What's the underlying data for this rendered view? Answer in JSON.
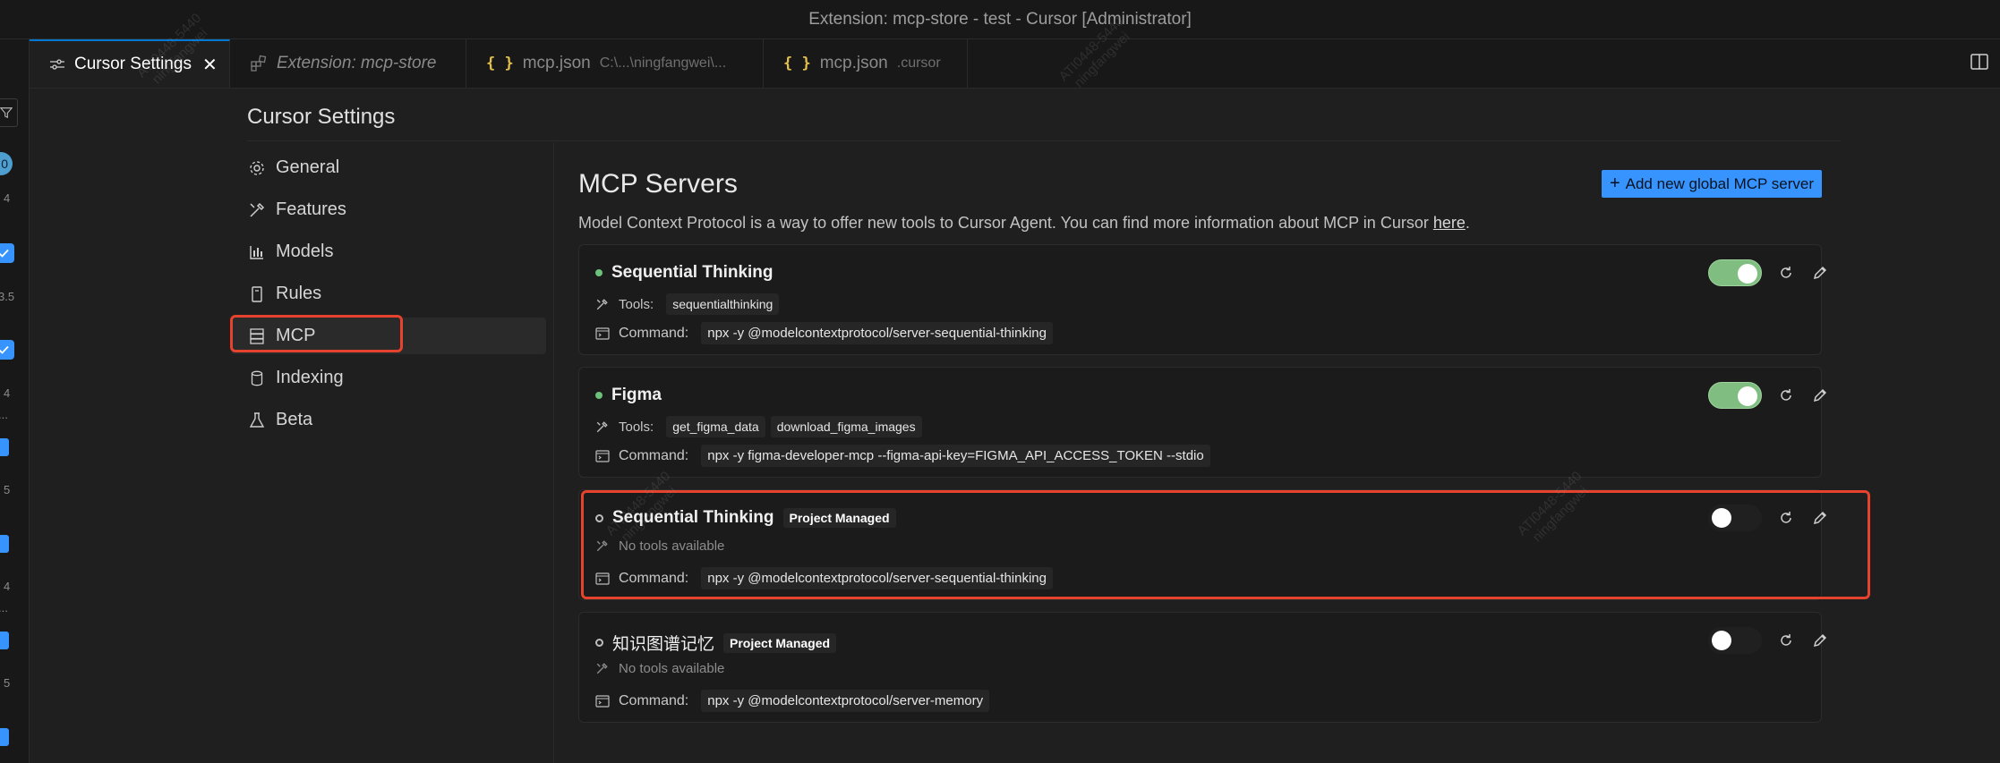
{
  "window": {
    "title": "Extension: mcp-store - test - Cursor [Administrator]"
  },
  "activity": {
    "badge": "0",
    "nums": [
      "4",
      "3.5",
      "4",
      "...",
      "5",
      "4",
      "...",
      "5"
    ]
  },
  "tabs": [
    {
      "label": "Cursor Settings",
      "icon": "settings-sliders-icon",
      "active": true
    },
    {
      "label": "Extension: mcp-store",
      "icon": "extensions-icon",
      "active": false
    },
    {
      "label": "mcp.json",
      "sub": "C:\\...\\ningfangwei\\...",
      "icon": "json-icon",
      "active": false
    },
    {
      "label": "mcp.json",
      "sub": ".cursor",
      "icon": "json-icon",
      "active": false
    }
  ],
  "settings": {
    "title": "Cursor Settings",
    "nav": [
      {
        "label": "General",
        "icon": "gear-icon"
      },
      {
        "label": "Features",
        "icon": "tools-icon"
      },
      {
        "label": "Models",
        "icon": "bar-chart-icon"
      },
      {
        "label": "Rules",
        "icon": "book-icon"
      },
      {
        "label": "MCP",
        "icon": "server-icon",
        "active": true
      },
      {
        "label": "Indexing",
        "icon": "database-icon"
      },
      {
        "label": "Beta",
        "icon": "flask-icon"
      }
    ]
  },
  "mcp": {
    "title": "MCP Servers",
    "desc_before": "Model Context Protocol is a way to offer new tools to Cursor Agent. You can find more information about MCP in Cursor ",
    "desc_link": "here",
    "desc_after": ".",
    "add_button": "Add new global MCP server",
    "tools_label": "Tools:",
    "command_label": "Command:",
    "servers": [
      {
        "name": "Sequential Thinking",
        "status": "enabled",
        "badge": "",
        "tools": [
          "sequentialthinking"
        ],
        "no_tools": "",
        "command": "npx -y @modelcontextprotocol/server-sequential-thinking"
      },
      {
        "name": "Figma",
        "status": "enabled",
        "badge": "",
        "tools": [
          "get_figma_data",
          "download_figma_images"
        ],
        "no_tools": "",
        "command": "npx -y figma-developer-mcp --figma-api-key=FIGMA_API_ACCESS_TOKEN --stdio"
      },
      {
        "name": "Sequential Thinking",
        "status": "disabled",
        "badge": "Project Managed",
        "tools": [],
        "no_tools": "No tools available",
        "command": "npx -y @modelcontextprotocol/server-sequential-thinking"
      },
      {
        "name": "知识图谱记忆",
        "status": "disabled",
        "badge": "Project Managed",
        "tools": [],
        "no_tools": "No tools available",
        "command": "npx -y @modelcontextprotocol/server-memory"
      }
    ]
  },
  "watermark": {
    "line1": "ATI0448-5440",
    "line2": "ningfangwei"
  },
  "colors": {
    "accent": "#3794ff",
    "highlight": "#e5432d",
    "toggle_on": "#7fbe80",
    "status_on": "#6cc27a"
  }
}
